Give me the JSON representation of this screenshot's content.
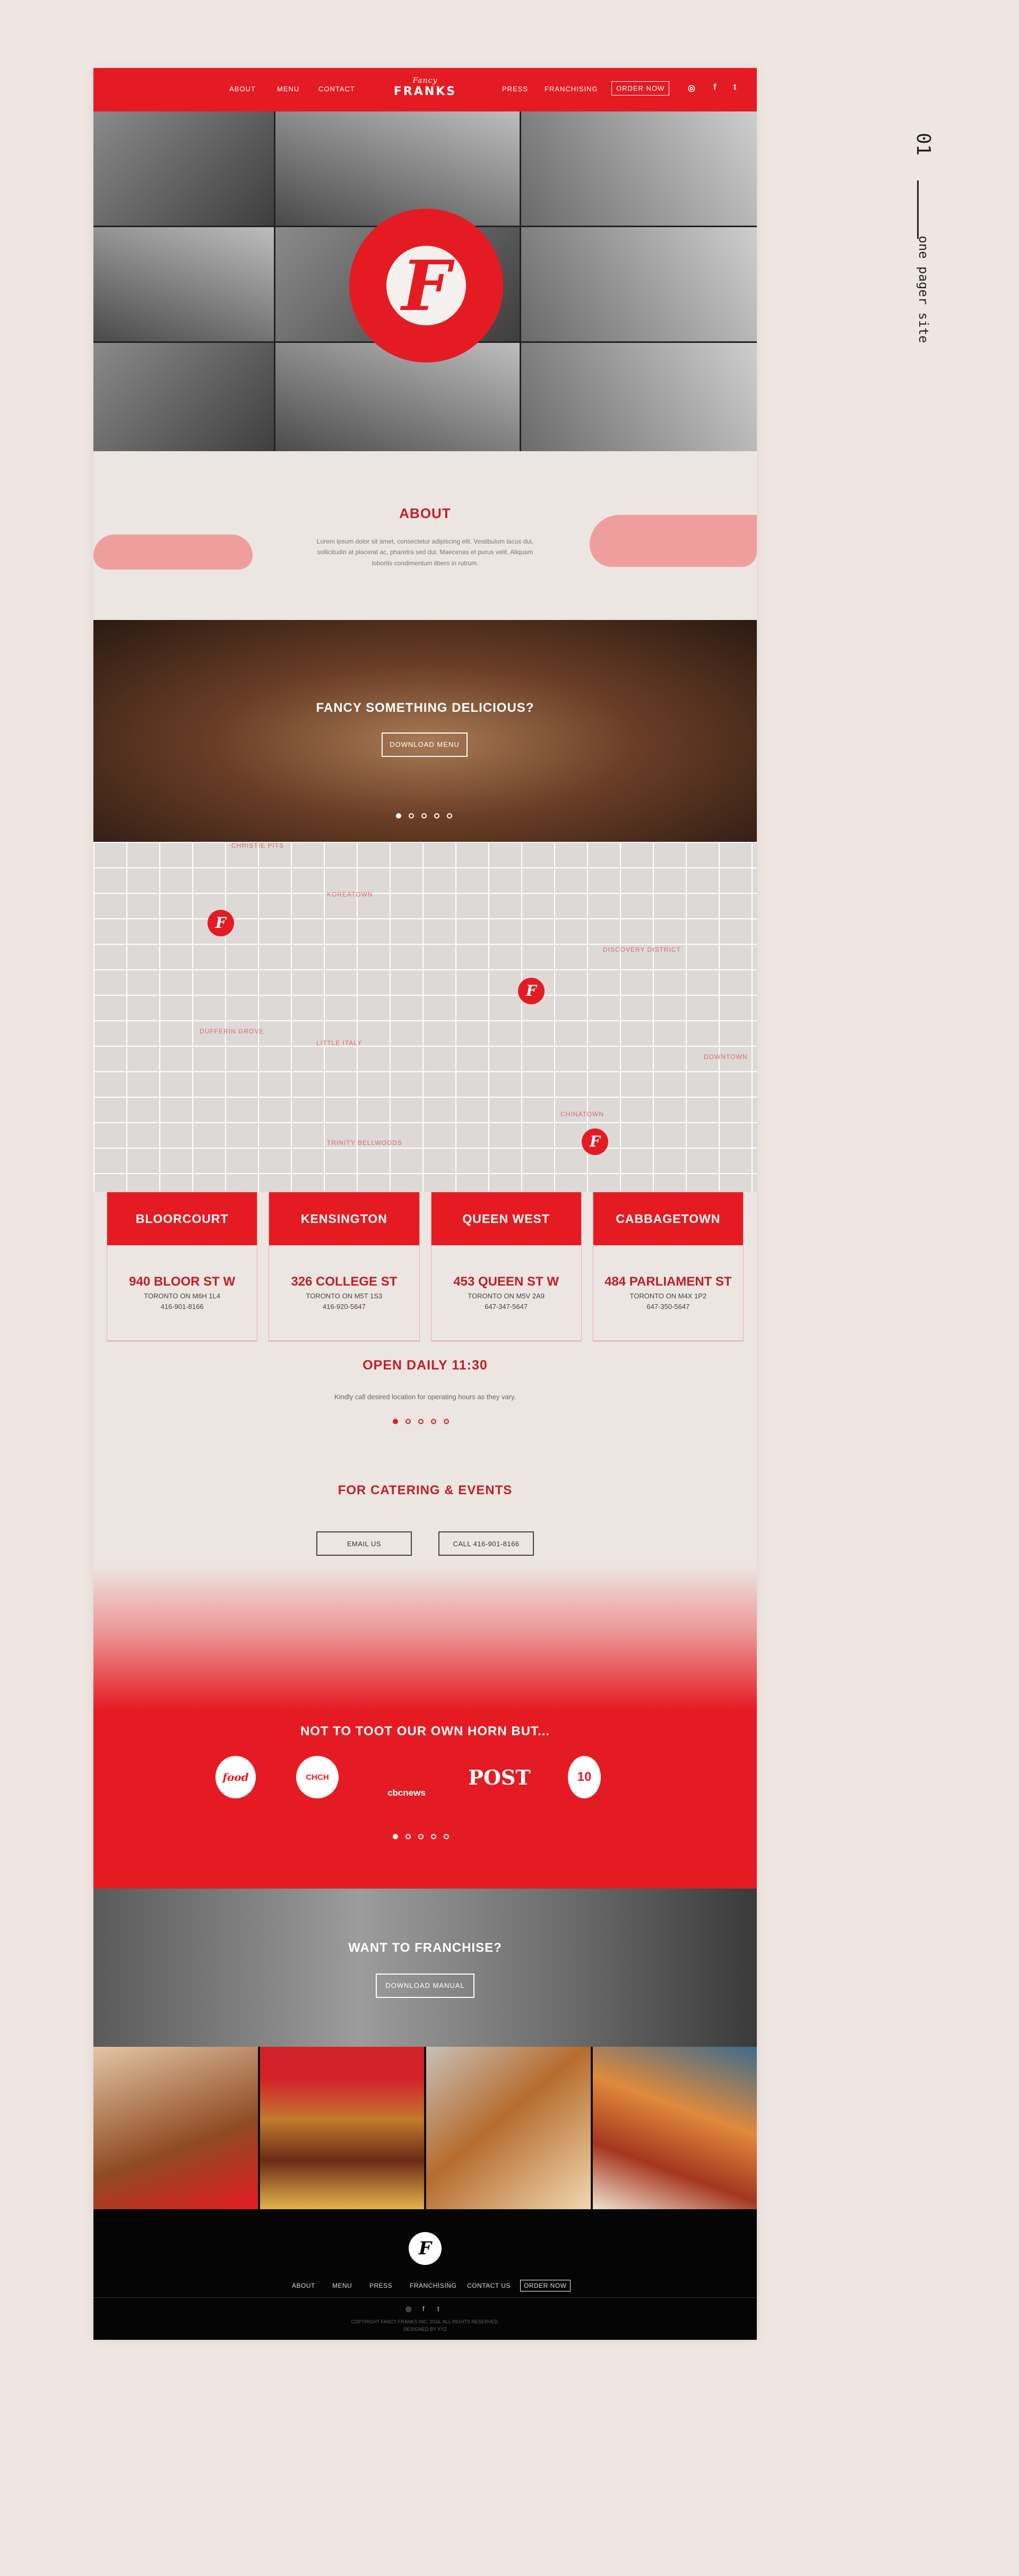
{
  "side": {
    "num": "01",
    "text": "one pager site"
  },
  "nav": {
    "about": "ABOUT",
    "menu": "MENU",
    "contact": "CONTACT",
    "logo_script": "Fancy",
    "logo_main": "FRANKS",
    "press": "PRESS",
    "franchising": "FRANCHISING",
    "order": "ORDER NOW",
    "instagram": "◎",
    "facebook": "f",
    "twitter": "t"
  },
  "hero": {
    "badge": "F"
  },
  "about": {
    "title": "ABOUT",
    "body": "Lorem ipsum dolor sit amet, consectetur adipiscing elit. Vestibulum lacus dui, sollicitudin at placerat ac, pharetra sed dui. Maecenas et purus velit. Aliquam lobortis condimentum libero in rutrum."
  },
  "menu": {
    "title": "FANCY SOMETHING DELICIOUS?",
    "button": "DOWNLOAD MENU"
  },
  "map": {
    "pin": "F",
    "labels": [
      "CHRISTIE PITS",
      "KOREATOWN",
      "DUFFERIN GROVE",
      "LITTLE ITALY",
      "TRINITY BELLWOODS",
      "CHINATOWN",
      "DOWNTOWN",
      "DISCOVERY DISTRICT"
    ]
  },
  "locations": [
    {
      "name": "BLOORCOURT",
      "address": "940 BLOOR ST W",
      "city": "TORONTO ON M6H 1L4",
      "phone": "416-901-8166"
    },
    {
      "name": "KENSINGTON",
      "address": "326 COLLEGE ST",
      "city": "TORONTO ON M5T 1S3",
      "phone": "416-920-5647"
    },
    {
      "name": "QUEEN WEST",
      "address": "453 QUEEN ST W",
      "city": "TORONTO ON M5V 2A9",
      "phone": "647-347-5647"
    },
    {
      "name": "CABBAGETOWN",
      "address": "484 PARLIAMENT ST",
      "city": "TORONTO ON M4X 1P2",
      "phone": "647-350-5647"
    }
  ],
  "hours": {
    "title": "OPEN DAILY 11:30",
    "note": "Kindly call desired location for operating hours as they vary."
  },
  "catering": {
    "title": "FOR CATERING & EVENTS",
    "email": "EMAIL US",
    "call": "CALL 416-901-8166"
  },
  "press": {
    "title": "NOT TO TOOT OUR OWN HORN BUT...",
    "logos": [
      "food",
      "CHCH",
      "cbcnews",
      "POST",
      "10"
    ]
  },
  "franchise": {
    "title": "WANT TO FRANCHISE?",
    "button": "DOWNLOAD MANUAL"
  },
  "footer": {
    "logo": "F",
    "about": "ABOUT",
    "menu": "MENU",
    "press": "PRESS",
    "franchising": "FRANCHISING",
    "contact": "CONTACT US",
    "order": "ORDER NOW",
    "instagram": "◎",
    "facebook": "f",
    "twitter": "t",
    "copyright": "COPYRIGHT FANCY FRANKS INC. 2016. ALL RIGHTS RESERVED.",
    "credit": "DESIGNED BY XYZ"
  },
  "colors": {
    "brand_red": "#e51b23",
    "dark_red": "#c31d25",
    "background": "#ece6e2",
    "footer": "#050505"
  }
}
